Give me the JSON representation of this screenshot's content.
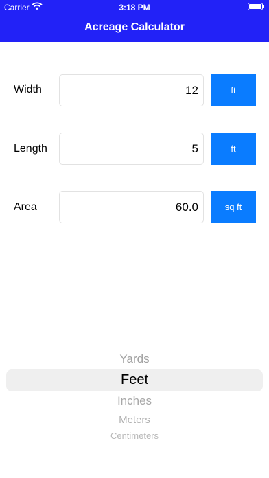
{
  "status_bar": {
    "carrier": "Carrier",
    "time": "3:18 PM"
  },
  "nav": {
    "title": "Acreage Calculator"
  },
  "rows": [
    {
      "label": "Width",
      "value": "12",
      "unit": "ft"
    },
    {
      "label": "Length",
      "value": "5",
      "unit": "ft"
    },
    {
      "label": "Area",
      "value": "60.0",
      "unit": "sq ft"
    }
  ],
  "picker": {
    "options": [
      "Yards",
      "Feet",
      "Inches",
      "Meters",
      "Centimeters"
    ],
    "selected": "Feet"
  },
  "colors": {
    "header": "#2222f7",
    "button": "#0a7cff"
  }
}
